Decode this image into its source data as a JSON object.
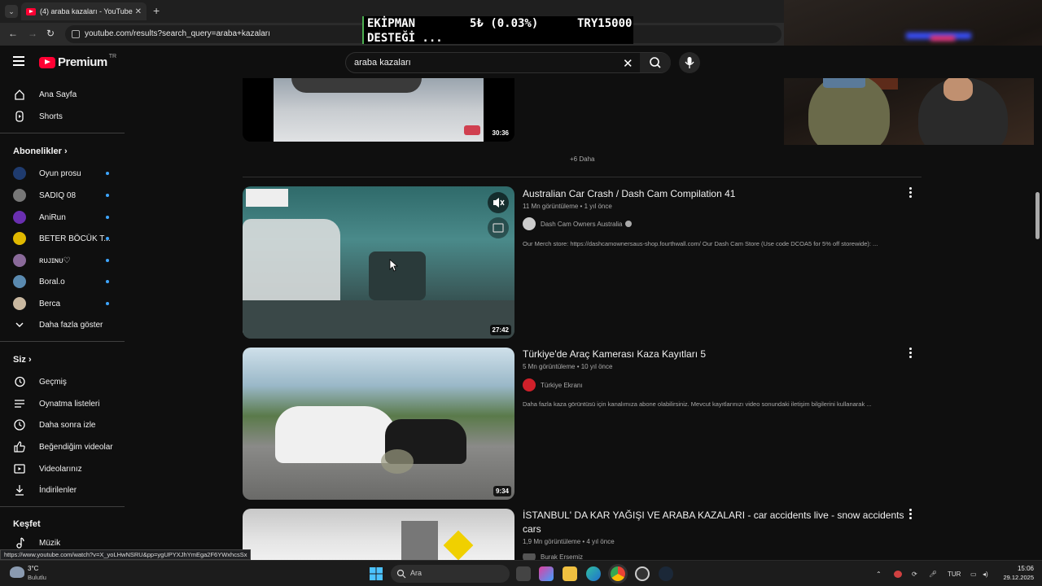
{
  "browser": {
    "tab_count_badge": "⌄",
    "tab_title": "(4) araba kazaları - YouTube",
    "tab_close": "✕",
    "new_tab": "+",
    "url": "youtube.com/results?search_query=araba+kazaları",
    "status_url": "https://www.youtube.com/watch?v=X_yoLHwNSRU&pp=ygUPYXJhYmEga2F6YWxhcsSx"
  },
  "stream_overlay": {
    "label_line1": "EKİPMAN",
    "label_line2": "DESTEĞİ ...",
    "change": "5₺ (0.03%)",
    "amount": "TRY15000"
  },
  "header": {
    "logo_text": "Premium",
    "logo_country": "TR",
    "search_value": "araba kazaları"
  },
  "sidebar": {
    "main": [
      {
        "label": "Ana Sayfa",
        "icon": "home-icon"
      },
      {
        "label": "Shorts",
        "icon": "shorts-icon"
      }
    ],
    "subs_heading": "Abonelikler",
    "subs": [
      {
        "label": "Oyun prosu",
        "color": "#1f3b6e"
      },
      {
        "label": "SADIQ 08",
        "color": "#777777"
      },
      {
        "label": "AniRun",
        "color": "#6a2fb0"
      },
      {
        "label": "BETER BÖCÜK T...",
        "color": "#e0b800"
      },
      {
        "label": "ʀᴜᴊɪɴᴜ♡",
        "color": "#8a6a9a"
      },
      {
        "label": "Boral.o",
        "color": "#5a8ab0"
      },
      {
        "label": "Berca",
        "color": "#c9b8a0"
      }
    ],
    "show_more": "Daha fazla göster",
    "you_heading": "Siz",
    "you_items": [
      {
        "label": "Geçmiş",
        "icon": "history-icon"
      },
      {
        "label": "Oynatma listeleri",
        "icon": "playlist-icon"
      },
      {
        "label": "Daha sonra izle",
        "icon": "clock-icon"
      },
      {
        "label": "Beğendiğim videolar",
        "icon": "thumbs-up-icon"
      },
      {
        "label": "Videolarınız",
        "icon": "video-icon"
      },
      {
        "label": "İndirilenler",
        "icon": "download-icon"
      }
    ],
    "explore_heading": "Keşfet",
    "explore_items": [
      {
        "label": "Müzik",
        "icon": "music-icon"
      }
    ]
  },
  "results": {
    "top_duration": "30:36",
    "more_label": "+6 Daha",
    "videos": [
      {
        "title": "Australian Car Crash / Dash Cam Compilation 41",
        "meta": "11 Mn görüntüleme • 1 yıl önce",
        "channel": "Dash Cam Owners Australia",
        "verified": true,
        "description": "Our Merch store: https://dashcamownersaus-shop.fourthwall.com/ Our Dash Cam Store (Use code DCOA5 for 5% off storewide): ...",
        "duration": "27:42"
      },
      {
        "title": "Türkiye'de Araç Kamerası Kaza Kayıtları 5",
        "meta": "5 Mn görüntüleme • 10 yıl önce",
        "channel": "Türkiye Ekranı",
        "description": "Daha fazla kaza görüntüsü için kanalımıza abone olabilirsiniz. Mevcut kayıtlarınızı video sonundaki iletişim bilgilerini kullanarak ...",
        "duration": "9:34"
      },
      {
        "title": "İSTANBUL' DA KAR YAĞIŞI VE ARABA KAZALARI - car accidents live - snow accidents cars",
        "meta": "1,9 Mn görüntüleme • 4 yıl önce",
        "channel": "Burak Ersemiz"
      }
    ]
  },
  "taskbar": {
    "weather_temp": "3°C",
    "weather_desc": "Bulutlu",
    "search_label": "Ara",
    "lang": "TUR",
    "time": "15:06",
    "date": "29.12.2025"
  }
}
